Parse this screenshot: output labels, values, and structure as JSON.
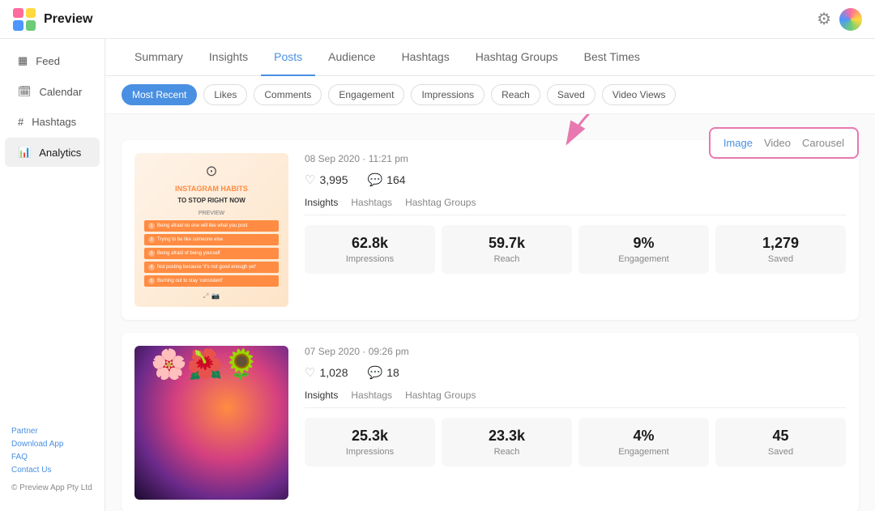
{
  "header": {
    "title": "Preview",
    "settings_label": "⚙",
    "app_icon_colors": [
      "#ff6b9d",
      "#ffd93d",
      "#6bcb77",
      "#4d96ff"
    ]
  },
  "sidebar": {
    "items": [
      {
        "id": "feed",
        "label": "Feed",
        "icon": "▦",
        "active": false
      },
      {
        "id": "calendar",
        "label": "Calendar",
        "icon": "📅",
        "active": false
      },
      {
        "id": "hashtags",
        "label": "Hashtags",
        "icon": "#",
        "active": false
      },
      {
        "id": "analytics",
        "label": "Analytics",
        "icon": "📊",
        "active": true
      }
    ],
    "footer": {
      "links": [
        "Partner",
        "Download App",
        "FAQ",
        "Contact Us"
      ],
      "copyright": "© Preview App Pty Ltd"
    }
  },
  "nav_tabs": {
    "items": [
      {
        "id": "summary",
        "label": "Summary",
        "active": false
      },
      {
        "id": "insights",
        "label": "Insights",
        "active": false
      },
      {
        "id": "posts",
        "label": "Posts",
        "active": true
      },
      {
        "id": "audience",
        "label": "Audience",
        "active": false
      },
      {
        "id": "hashtags",
        "label": "Hashtags",
        "active": false
      },
      {
        "id": "hashtag-groups",
        "label": "Hashtag Groups",
        "active": false
      },
      {
        "id": "best-times",
        "label": "Best Times",
        "active": false
      }
    ]
  },
  "filter_bar": {
    "items": [
      {
        "id": "most-recent",
        "label": "Most Recent",
        "active": true
      },
      {
        "id": "likes",
        "label": "Likes",
        "active": false
      },
      {
        "id": "comments",
        "label": "Comments",
        "active": false
      },
      {
        "id": "engagement",
        "label": "Engagement",
        "active": false
      },
      {
        "id": "impressions",
        "label": "Impressions",
        "active": false
      },
      {
        "id": "reach",
        "label": "Reach",
        "active": false
      },
      {
        "id": "saved",
        "label": "Saved",
        "active": false
      },
      {
        "id": "video-views",
        "label": "Video Views",
        "active": false
      }
    ]
  },
  "type_filter": {
    "items": [
      {
        "id": "image",
        "label": "Image",
        "active": true
      },
      {
        "id": "video",
        "label": "Video",
        "active": false
      },
      {
        "id": "carousel",
        "label": "Carousel",
        "active": false
      }
    ]
  },
  "posts": [
    {
      "id": "post1",
      "date": "08 Sep 2020 · 11:21 pm",
      "likes": "3,995",
      "comments": "164",
      "post_tabs": [
        {
          "label": "Insights",
          "active": true
        },
        {
          "label": "Hashtags",
          "active": false
        },
        {
          "label": "Hashtag Groups",
          "active": false
        }
      ],
      "metrics": [
        {
          "value": "62.8k",
          "label": "Impressions"
        },
        {
          "value": "59.7k",
          "label": "Reach"
        },
        {
          "value": "9%",
          "label": "Engagement"
        },
        {
          "value": "1,279",
          "label": "Saved"
        }
      ],
      "thumbnail_type": "instagram-habits",
      "thumbnail_title": "INSTAGRAM HABITS",
      "thumbnail_subtitle": "TO STOP RIGHT NOW",
      "thumbnail_items": [
        "Being afraid no one will like what you post",
        "Trying to be like someone else",
        "Being afraid of being yourself",
        "Not posting because 'it's not good enough yet'",
        "Burning out to stay 'consistent'"
      ]
    },
    {
      "id": "post2",
      "date": "07 Sep 2020 · 09:26 pm",
      "likes": "1,028",
      "comments": "18",
      "post_tabs": [
        {
          "label": "Insights",
          "active": true
        },
        {
          "label": "Hashtags",
          "active": false
        },
        {
          "label": "Hashtag Groups",
          "active": false
        }
      ],
      "metrics": [
        {
          "value": "25.3k",
          "label": "Impressions"
        },
        {
          "value": "23.3k",
          "label": "Reach"
        },
        {
          "value": "4%",
          "label": "Engagement"
        },
        {
          "value": "45",
          "label": "Saved"
        }
      ],
      "thumbnail_type": "portrait"
    }
  ]
}
